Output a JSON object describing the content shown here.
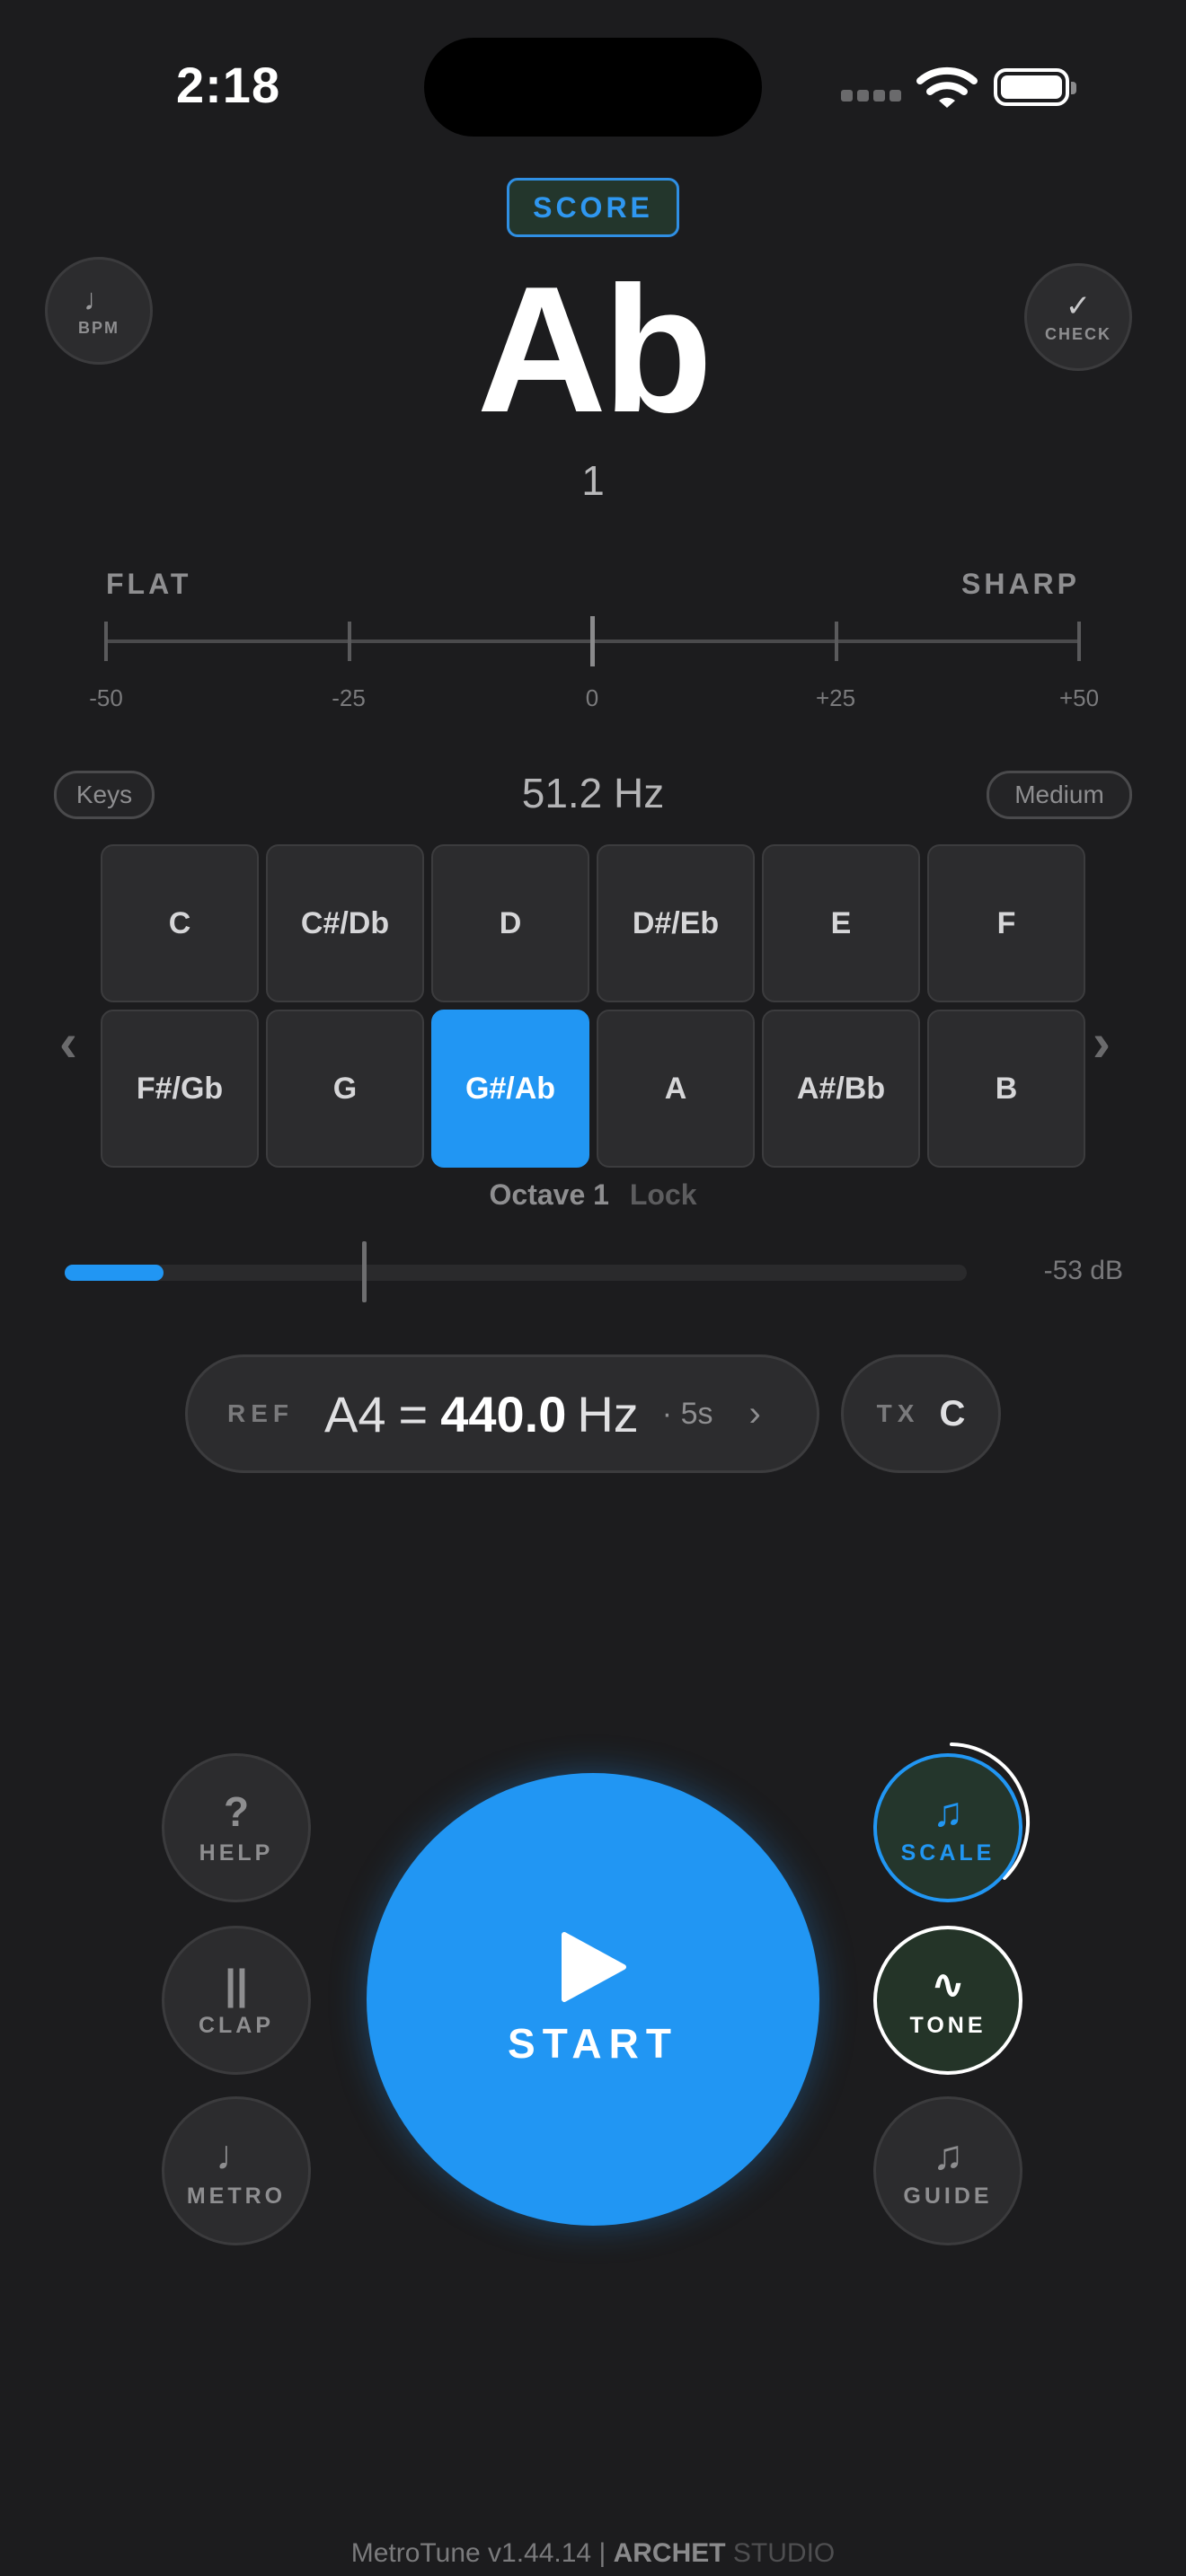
{
  "status_bar": {
    "time": "2:18"
  },
  "score_label": "SCORE",
  "bpm": {
    "icon": "♩",
    "label": "BPM"
  },
  "check": {
    "icon": "✓",
    "label": "CHECK"
  },
  "note": {
    "name": "Ab",
    "octave": "1"
  },
  "meter": {
    "flat_label": "FLAT",
    "sharp_label": "SHARP",
    "ticks": [
      "-50",
      "-25",
      "0",
      "+25",
      "+50"
    ]
  },
  "keys_label": "Keys",
  "difficulty_label": "Medium",
  "frequency": "51.2 Hz",
  "keys": [
    "C",
    "C#/Db",
    "D",
    "D#/Eb",
    "E",
    "F",
    "F#/Gb",
    "G",
    "G#/Ab",
    "A",
    "A#/Bb",
    "B"
  ],
  "active_key": "G#/Ab",
  "nav": {
    "prev": "‹",
    "next": "›"
  },
  "octave_selector": {
    "label": "Octave 1",
    "lock": "Lock"
  },
  "level": {
    "db": "-53 dB",
    "fill_fraction": 0.11,
    "marker_fraction": 0.33
  },
  "reference": {
    "label": "REF",
    "note": "A4",
    "eq": "=",
    "value": "440.0",
    "unit": "Hz",
    "duration": "· 5s",
    "chevron": "›"
  },
  "transpose": {
    "label": "TX",
    "value": "C"
  },
  "controls": {
    "help": {
      "icon": "?",
      "label": "HELP"
    },
    "clap": {
      "icon": "||",
      "label": "CLAP"
    },
    "metro": {
      "icon": "♩",
      "label": "METRO"
    },
    "scale": {
      "icon": "♫",
      "label": "SCALE"
    },
    "tone": {
      "icon": "∿",
      "label": "TONE"
    },
    "guide": {
      "icon": "♫",
      "label": "GUIDE"
    }
  },
  "start": {
    "label": "START"
  },
  "footer": {
    "app": "MetroTune v1.44.14 | ",
    "brand": "ARCHET",
    "studio": " STUDIO"
  },
  "colors": {
    "accent": "#2196f3",
    "background": "#1c1c1e",
    "button": "#2c2c2e"
  }
}
